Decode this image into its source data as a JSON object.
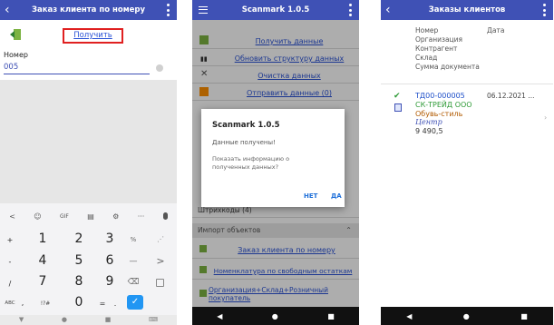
{
  "p1": {
    "title": "Заказ клиента по номеру",
    "get_button": "Получить",
    "number_label": "Номер",
    "number_value": "005",
    "kbd_toolbar": [
      "<",
      "☺",
      "GIF",
      "▤",
      "⚙",
      "···",
      "🎤"
    ],
    "keys": [
      [
        "+",
        "1",
        "2",
        "3",
        "%",
        "⋰"
      ],
      [
        "-",
        "4",
        "5",
        "6",
        "—",
        ">"
      ],
      [
        "/",
        "7",
        "8",
        "9",
        "⌫",
        ""
      ],
      [
        "ABC",
        ",",
        "!?#",
        "0",
        "=",
        "."
      ]
    ],
    "nav": [
      "▼",
      "●",
      "■",
      "⌨"
    ]
  },
  "p2": {
    "title": "Scanmark 1.0.5",
    "items": [
      "Получить данные",
      "Обновить структуру данных",
      "Очистка данных",
      "Отправить данные (0)"
    ],
    "item_icons": [
      "download-icon",
      "barcode-icon",
      "clear-icon",
      "upload-icon"
    ],
    "behind_item": "Штрихкоды (4)",
    "section": "Импорт объектов",
    "imports": [
      "Заказ клиента по номеру",
      "Номенклатура по свободным остаткам",
      "Организация+Склад+Розничный покупатель"
    ],
    "dialog": {
      "title": "Scanmark 1.0.5",
      "message": "Данные получены!",
      "question": "Показать информацию о полученных данных?",
      "no": "НЕТ",
      "yes": "ДА"
    },
    "nav": [
      "◀",
      "●",
      "■"
    ]
  },
  "p3": {
    "title": "Заказы клиентов",
    "header_col1": [
      "Номер",
      "Организация",
      "Контрагент",
      "Склад",
      "Сумма документа"
    ],
    "header_col2": "Дата",
    "order": {
      "number": "ТД00-000005",
      "org": "СК-ТРЕЙД ООО",
      "contragent": "Обувь-стиль",
      "warehouse": "Центр",
      "sum": "9 490,5",
      "date": "06.12.2021 ..."
    },
    "nav": [
      "◀",
      "●",
      "■"
    ]
  },
  "colors": {
    "primary": "#3f51b5",
    "link": "#2a52d6",
    "highlight": "#e02020",
    "green": "#2e9a36",
    "accent": "#2196f3"
  }
}
